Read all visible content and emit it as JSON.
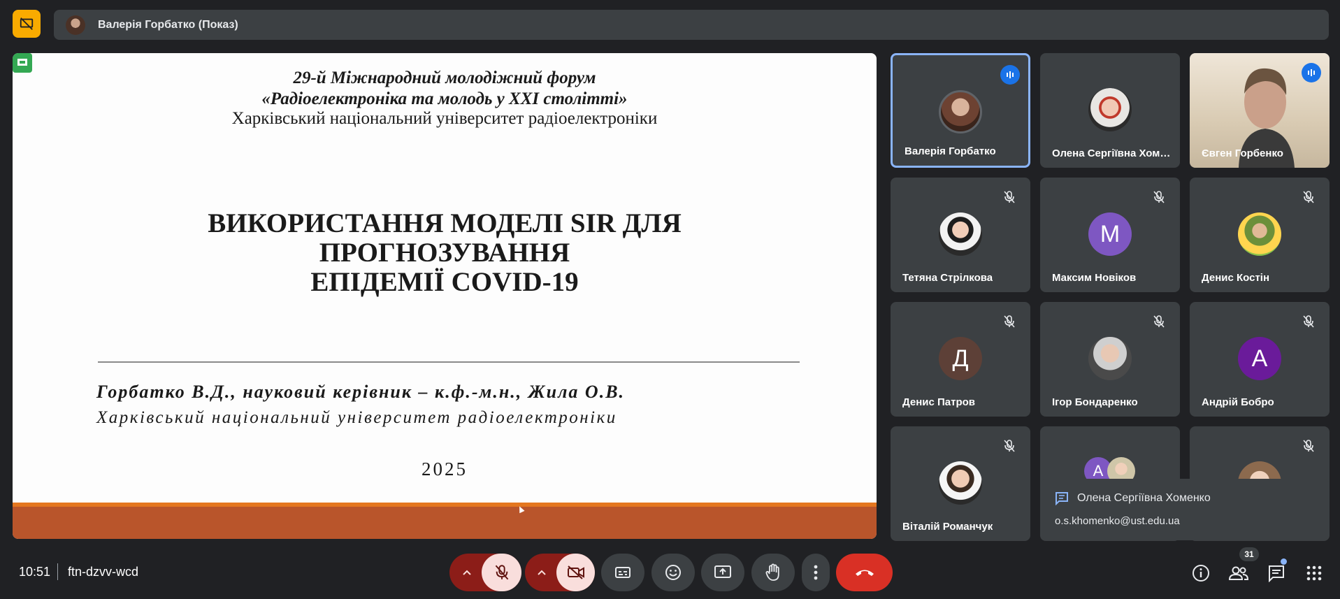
{
  "top_bar": {
    "presenter_label": "Валерія Горбатко (Показ)",
    "icons": [
      "presentation-off-icon"
    ]
  },
  "slide": {
    "forum_line1": "29-й Міжнародний молодіжний форум",
    "forum_line2": "«Радіоелектроніка та молодь у XXI столітті»",
    "university": "Харківський національний університет радіоелектроніки",
    "title_line1": "ВИКОРИСТАННЯ МОДЕЛІ SIR ДЛЯ",
    "title_line2": "ПРОГНОЗУВАННЯ",
    "title_line3": "ЕПІДЕМІЇ COVID-19",
    "authors": "Горбатко В.Д., науковий керівник – к.ф.-м.н., Жила О.В.",
    "affiliation": "Харківський національний університет радіоелектроніки",
    "year": "2025"
  },
  "participants": [
    {
      "name": "Валерія Горбатко",
      "state": "speaking",
      "avatar": "photo"
    },
    {
      "name": "Олена Сергіївна Хоменко",
      "state": "none",
      "avatar": "photo"
    },
    {
      "name": "Євген Горбенко",
      "state": "speaking",
      "avatar": "video"
    },
    {
      "name": "Тетяна Стрілкова",
      "state": "muted",
      "avatar": "photo"
    },
    {
      "name": "Максим Новіков",
      "state": "muted",
      "avatar": "letter",
      "letter": "M",
      "color": "#7e57c2"
    },
    {
      "name": "Денис Костін",
      "state": "muted",
      "avatar": "photo"
    },
    {
      "name": "Денис Патров",
      "state": "muted",
      "avatar": "letter",
      "letter": "Д",
      "color": "#5d4037"
    },
    {
      "name": "Ігор Бондаренко",
      "state": "muted",
      "avatar": "photo"
    },
    {
      "name": "Андрій Бобро",
      "state": "muted",
      "avatar": "letter",
      "letter": "A",
      "color": "#6a1b9a"
    },
    {
      "name": "Віталій Романчук",
      "state": "muted",
      "avatar": "photo"
    }
  ],
  "overflow_tile": {
    "letter": "A",
    "color": "#7e57c2"
  },
  "notification": {
    "sender": "Олена Сергіївна Хоменко",
    "message": "o.s.khomenko@ust.edu.ua"
  },
  "bottom_bar": {
    "time": "10:51",
    "meeting_code": "ftn-dzvv-wcd",
    "people_count": "31"
  }
}
